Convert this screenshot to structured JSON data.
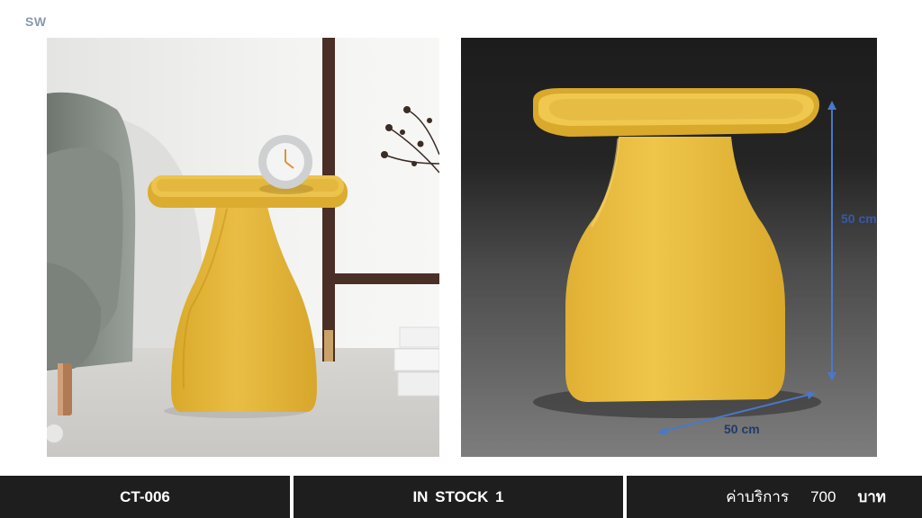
{
  "brand": "SW",
  "images": {
    "left": "yellow side table beside grey armchair with white clock",
    "right": "yellow side table with dimension lines"
  },
  "dimensions": {
    "height_label": "50 cm",
    "width_label": "50 cm"
  },
  "footer": {
    "product_code": "CT-006",
    "stock": "IN  STOCK  1",
    "price_label": "ค่าบริการ",
    "price_value": "700",
    "price_unit": "บาท"
  },
  "colors": {
    "table_yellow": "#e3b538",
    "footer_bg": "#1e1e1e",
    "dimension_line": "#4a78c8"
  }
}
